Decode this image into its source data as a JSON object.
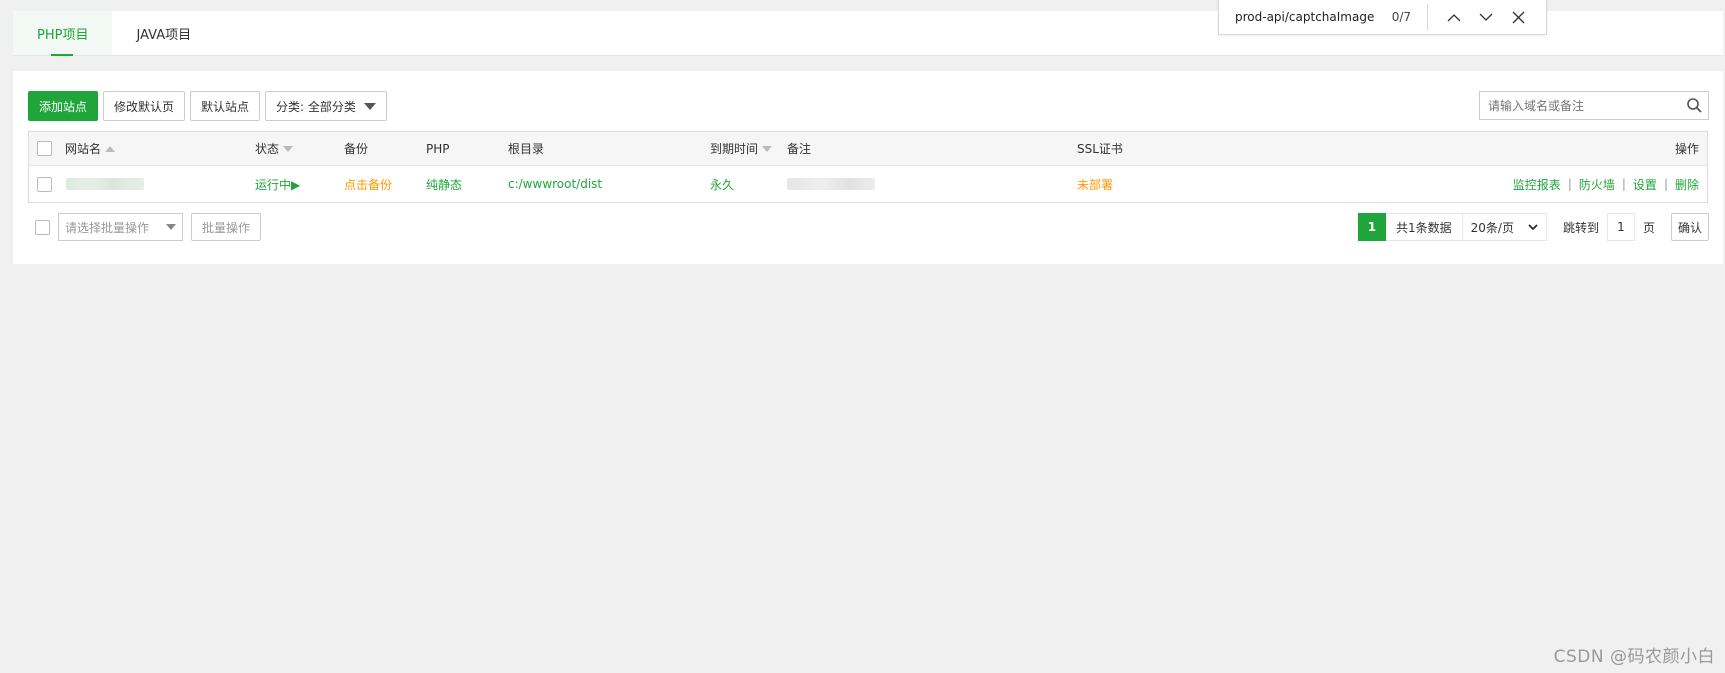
{
  "tabs": [
    {
      "label": "PHP项目",
      "active": true
    },
    {
      "label": "JAVA项目",
      "active": false
    }
  ],
  "findbar": {
    "query": "prod-api/captchaImage",
    "count": "0/7"
  },
  "toolbar": {
    "add_site": "添加站点",
    "edit_default_page": "修改默认页",
    "default_site": "默认站点",
    "category": "分类: 全部分类"
  },
  "search": {
    "placeholder": "请输入域名或备注"
  },
  "table": {
    "headers": {
      "site_name": "网站名",
      "status": "状态",
      "backup": "备份",
      "php": "PHP",
      "root": "根目录",
      "expire": "到期时间",
      "note": "备注",
      "ssl": "SSL证书",
      "ops": "操作"
    },
    "rows": [
      {
        "status": "运行中▶",
        "backup": "点击备份",
        "php": "纯静态",
        "root": "c:/wwwroot/dist",
        "expire": "永久",
        "ssl": "未部署",
        "ops": [
          "监控报表",
          "防火墙",
          "设置",
          "删除"
        ]
      }
    ]
  },
  "footer": {
    "batch_select_placeholder": "请选择批量操作",
    "batch_button": "批量操作",
    "current_page": "1",
    "total_text": "共1条数据",
    "per_page": "20条/页",
    "jump_label": "跳转到",
    "jump_value": "1",
    "page_unit": "页",
    "confirm": "确认"
  },
  "watermark": "CSDN @码农颜小白",
  "colors": {
    "accent": "#20a53a",
    "warning": "#ff9800"
  }
}
